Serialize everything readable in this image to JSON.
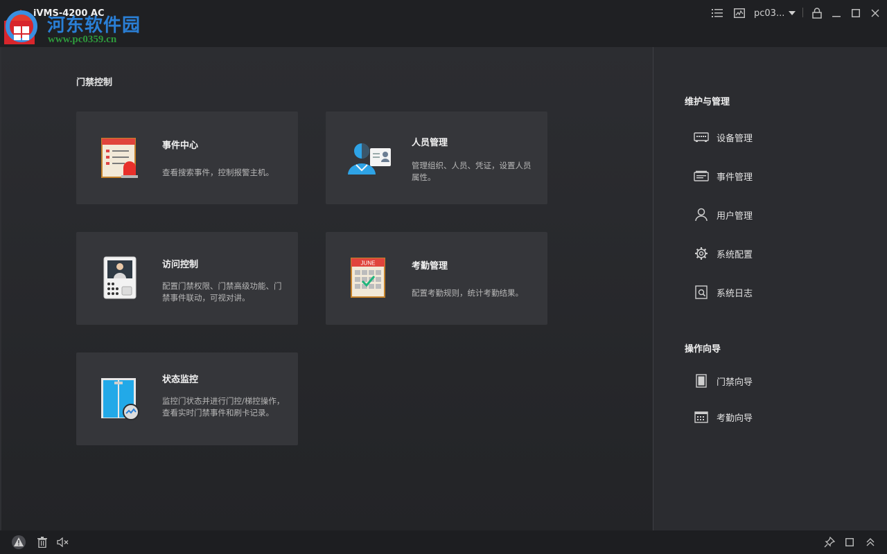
{
  "window": {
    "app_title": "iVMS-4200 AC",
    "username": "pc03...",
    "watermark": {
      "site_name": "河东软件园",
      "url": "www.pc0359.cn"
    }
  },
  "main": {
    "section_title": "门禁控制",
    "cards": [
      {
        "title": "事件中心",
        "description": "查看搜索事件，控制报警主机。",
        "icon": "event-center-icon"
      },
      {
        "title": "人员管理",
        "description": "管理组织、人员、凭证，设置人员属性。",
        "icon": "person-management-icon"
      },
      {
        "title": "访问控制",
        "description": "配置门禁权限、门禁高级功能、门禁事件联动，可视对讲。",
        "icon": "access-control-icon"
      },
      {
        "title": "考勤管理",
        "description": "配置考勤规则，统计考勤结果。",
        "icon": "attendance-icon",
        "calendar_label": "JUNE"
      },
      {
        "title": "状态监控",
        "description": "监控门状态并进行门控/梯控操作，查看实时门禁事件和刷卡记录。",
        "icon": "status-monitor-icon"
      }
    ]
  },
  "sidebar": {
    "maintenance_heading": "维护与管理",
    "maintenance_items": [
      {
        "label": "设备管理",
        "icon": "device-icon"
      },
      {
        "label": "事件管理",
        "icon": "event-icon"
      },
      {
        "label": "用户管理",
        "icon": "user-icon"
      },
      {
        "label": "系统配置",
        "icon": "gear-icon"
      },
      {
        "label": "系统日志",
        "icon": "log-icon"
      }
    ],
    "guide_heading": "操作向导",
    "guide_items": [
      {
        "label": "门禁向导",
        "icon": "door-icon"
      },
      {
        "label": "考勤向导",
        "icon": "calendar-icon"
      }
    ]
  },
  "colors": {
    "background": "#2a2b2e",
    "card": "#35363a",
    "titlebar": "#1f2023",
    "accent_red": "#e0443c",
    "accent_blue": "#2ea3e6"
  }
}
